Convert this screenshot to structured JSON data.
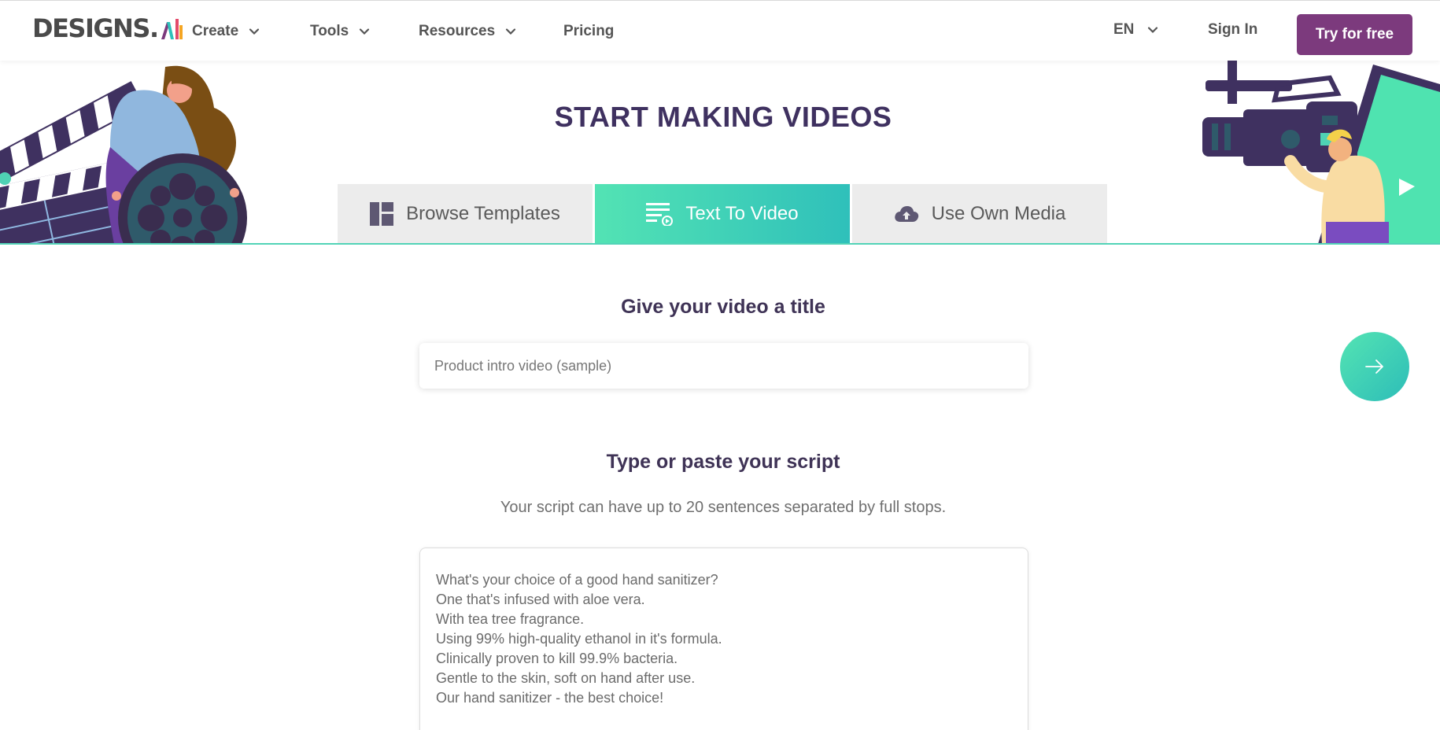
{
  "nav": {
    "logo_text": "DESIGNS.",
    "logo_ai": "AI",
    "items": [
      {
        "label": "Create",
        "has_dropdown": true
      },
      {
        "label": "Tools",
        "has_dropdown": true
      },
      {
        "label": "Resources",
        "has_dropdown": true
      },
      {
        "label": "Pricing",
        "has_dropdown": false
      }
    ],
    "language": "EN",
    "sign_in": "Sign In",
    "cta": "Try for free"
  },
  "hero": {
    "title": "START MAKING VIDEOS",
    "tabs": [
      {
        "label": "Browse Templates",
        "icon": "template-grid-icon",
        "active": false
      },
      {
        "label": "Text To Video",
        "icon": "text-lines-icon",
        "active": true
      },
      {
        "label": "Use Own Media",
        "icon": "cloud-upload-icon",
        "active": false
      }
    ]
  },
  "form": {
    "title_heading": "Give your video a title",
    "title_placeholder": "Product intro video (sample)",
    "next_icon": "arrow-right-icon",
    "script_heading": "Type or paste your script",
    "script_hint": "Your script can have up to 20 sentences separated by full stops.",
    "script_value": "What's your choice of a good hand sanitizer?\nOne that's infused with aloe vera.\nWith tea tree fragrance.\nUsing 99% high-quality ethanol in it's formula.\nClinically proven to kill 99.9% bacteria.\nGentle to the skin, soft on hand after use.\nOur hand sanitizer - the best choice!"
  },
  "colors": {
    "brand_purple": "#7c3a7d",
    "heading": "#3f3160",
    "accent_green": "#53e3b4",
    "accent_teal": "#2fc0ba"
  }
}
